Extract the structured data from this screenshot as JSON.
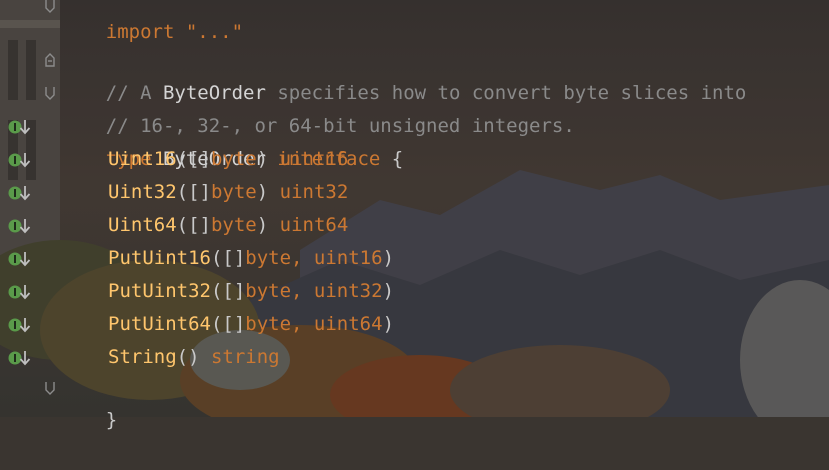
{
  "editor": {
    "top_fragment": "import \"...\"",
    "comment_line_1": {
      "prefix": "// A ",
      "ident": "ByteOrder",
      "rest": " specifies how to convert byte slices into"
    },
    "comment_line_2": "// 16-, 32-, or 64-bit unsigned integers.",
    "decl": {
      "type_kw": "type",
      "name": "ByteOrder",
      "iface_kw": "interface",
      "open_brace": "{"
    },
    "methods": [
      {
        "name": "Uint16",
        "open": "([]",
        "param": "byte",
        "param2": "",
        "close": ")",
        "ret": "uint16"
      },
      {
        "name": "Uint32",
        "open": "([]",
        "param": "byte",
        "param2": "",
        "close": ")",
        "ret": "uint32"
      },
      {
        "name": "Uint64",
        "open": "([]",
        "param": "byte",
        "param2": "",
        "close": ")",
        "ret": "uint64"
      },
      {
        "name": "PutUint16",
        "open": "([]",
        "param": "byte,",
        "param2": " uint16",
        "close": ")",
        "ret": ""
      },
      {
        "name": "PutUint32",
        "open": "([]",
        "param": "byte,",
        "param2": " uint32",
        "close": ")",
        "ret": ""
      },
      {
        "name": "PutUint64",
        "open": "([]",
        "param": "byte,",
        "param2": " uint64",
        "close": ")",
        "ret": ""
      },
      {
        "name": "String",
        "open": "()",
        "param": "",
        "param2": "",
        "close": "",
        "ret": "string"
      }
    ],
    "close_brace": "}",
    "colors": {
      "keyword": "#cc7832",
      "method": "#ffc66d",
      "comment": "#8a8a8a",
      "implement_marker": "#5a9a4a"
    },
    "gutter_icon": "implemented-by-icon"
  }
}
